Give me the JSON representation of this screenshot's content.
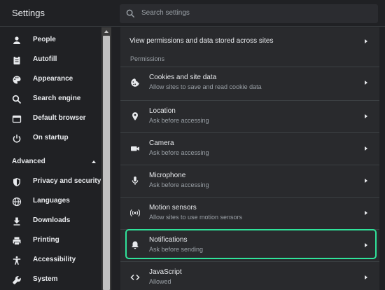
{
  "app": {
    "title": "Settings"
  },
  "search": {
    "placeholder": "Search settings"
  },
  "sidebar": {
    "items": [
      {
        "label": "People"
      },
      {
        "label": "Autofill"
      },
      {
        "label": "Appearance"
      },
      {
        "label": "Search engine"
      },
      {
        "label": "Default browser"
      },
      {
        "label": "On startup"
      }
    ],
    "advanced_label": "Advanced",
    "advanced_items": [
      {
        "label": "Privacy and security"
      },
      {
        "label": "Languages"
      },
      {
        "label": "Downloads"
      },
      {
        "label": "Printing"
      },
      {
        "label": "Accessibility"
      },
      {
        "label": "System"
      }
    ]
  },
  "main": {
    "top_row_label": "View permissions and data stored across sites",
    "permissions_header": "Permissions",
    "permissions": [
      {
        "title": "Cookies and site data",
        "subtitle": "Allow sites to save and read cookie data"
      },
      {
        "title": "Location",
        "subtitle": "Ask before accessing"
      },
      {
        "title": "Camera",
        "subtitle": "Ask before accessing"
      },
      {
        "title": "Microphone",
        "subtitle": "Ask before accessing"
      },
      {
        "title": "Motion sensors",
        "subtitle": "Allow sites to use motion sensors"
      },
      {
        "title": "Notifications",
        "subtitle": "Ask before sending"
      },
      {
        "title": "JavaScript",
        "subtitle": "Allowed"
      }
    ]
  },
  "colors": {
    "highlight": "#2fe39a",
    "background": "#202124",
    "panel": "#292a2d"
  }
}
